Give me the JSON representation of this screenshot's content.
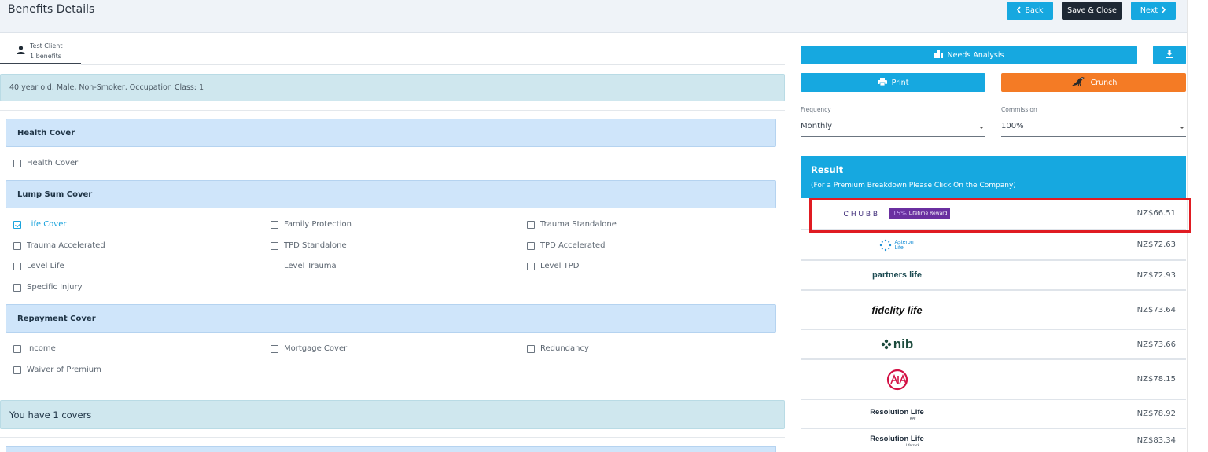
{
  "header": {
    "title": "Benefits Details",
    "back_label": "Back",
    "save_close_label": "Save & Close",
    "next_label": "Next"
  },
  "client_tab": {
    "name": "Test Client",
    "benefits": "1 benefits",
    "icon": "user-icon"
  },
  "client_info": "40 year old, Male, Non-Smoker, Occupation Class: 1",
  "sections": {
    "health": {
      "title": "Health Cover",
      "items": [
        "Health Cover"
      ]
    },
    "lump_sum": {
      "title": "Lump Sum Cover",
      "items": [
        "Life Cover",
        "Family Protection",
        "Trauma Standalone",
        "Trauma Accelerated",
        "TPD Standalone",
        "TPD Accelerated",
        "Level Life",
        "Level Trauma",
        "Level TPD",
        "Specific Injury"
      ],
      "checked": [
        "Life Cover"
      ]
    },
    "repayment": {
      "title": "Repayment Cover",
      "items": [
        "Income",
        "Mortgage Cover",
        "Redundancy",
        "Waiver of Premium"
      ]
    }
  },
  "covers_summary": "You have 1 covers",
  "actions": {
    "needs_analysis": "Needs Analysis",
    "print": "Print",
    "crunch": "Crunch",
    "download_icon": "download-icon"
  },
  "frequency": {
    "label": "Frequency",
    "value": "Monthly"
  },
  "commission": {
    "label": "Commission",
    "value": "100%"
  },
  "result": {
    "title": "Result",
    "subtitle": "(For a Premium Breakdown Please Click On the Company)",
    "rows": [
      {
        "company": "CHUBB",
        "badge_pct": "15%",
        "badge_text": "Lifetime Reward",
        "price": "NZ$66.51"
      },
      {
        "company": "Asteron Life",
        "price": "NZ$72.63"
      },
      {
        "company": "partners life",
        "price": "NZ$72.93"
      },
      {
        "company": "fidelity life",
        "price": "NZ$73.64"
      },
      {
        "company": "nib",
        "price": "NZ$73.66"
      },
      {
        "company": "AIA",
        "price": "NZ$78.15"
      },
      {
        "company": "Resolution Life",
        "sub": "RPP",
        "price": "NZ$78.92"
      },
      {
        "company": "Resolution Life",
        "sub": "Lifetrack",
        "price": "NZ$83.34"
      }
    ]
  },
  "colors": {
    "accent_blue": "#16a8e0",
    "orange": "#f47b25",
    "highlight_red": "#e01b22",
    "chubb_purple": "#6a2fa0"
  }
}
